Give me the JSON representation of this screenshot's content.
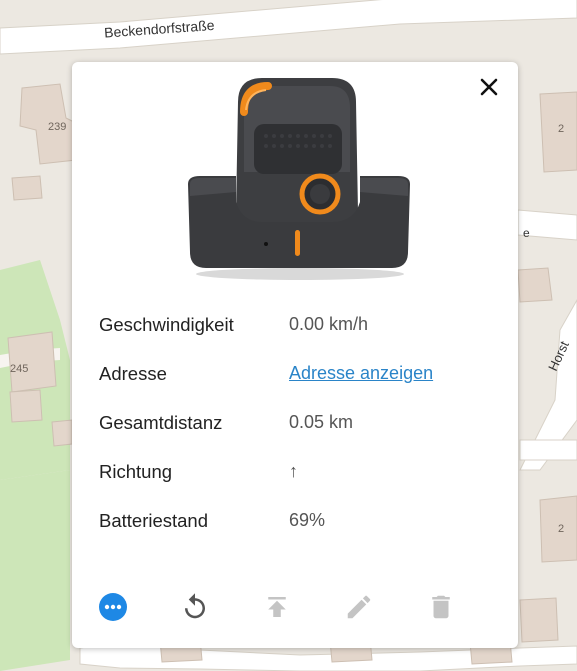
{
  "map": {
    "street_name": "Beckendorfstraße",
    "street_name_2": "Horst",
    "house_numbers": [
      "239",
      "245",
      "2",
      "2"
    ],
    "street_suffix": "e"
  },
  "popup": {
    "close_icon": "close-icon",
    "device_image": "tracker-with-charging-dock",
    "rows": [
      {
        "label": "Geschwindigkeit",
        "value": "0.00 km/h"
      },
      {
        "label": "Adresse",
        "value": "Adresse anzeigen"
      },
      {
        "label": "Gesamtdistanz",
        "value": "0.05 km"
      },
      {
        "label": "Richtung",
        "value": "↑"
      },
      {
        "label": "Batteriestand",
        "value": "69%"
      }
    ],
    "toolbar": [
      {
        "icon": "more-icon",
        "active": true
      },
      {
        "icon": "replay-icon",
        "active": true
      },
      {
        "icon": "upload-command-icon",
        "active": false
      },
      {
        "icon": "edit-icon",
        "active": false
      },
      {
        "icon": "delete-icon",
        "active": false
      }
    ]
  },
  "colors": {
    "link": "#2a84c8",
    "primary": "#1e88e5",
    "disabled_icon": "#c4c4c4",
    "map_background": "#ece8e1",
    "map_green": "#cde6b8",
    "building": "#e3d6cb"
  }
}
